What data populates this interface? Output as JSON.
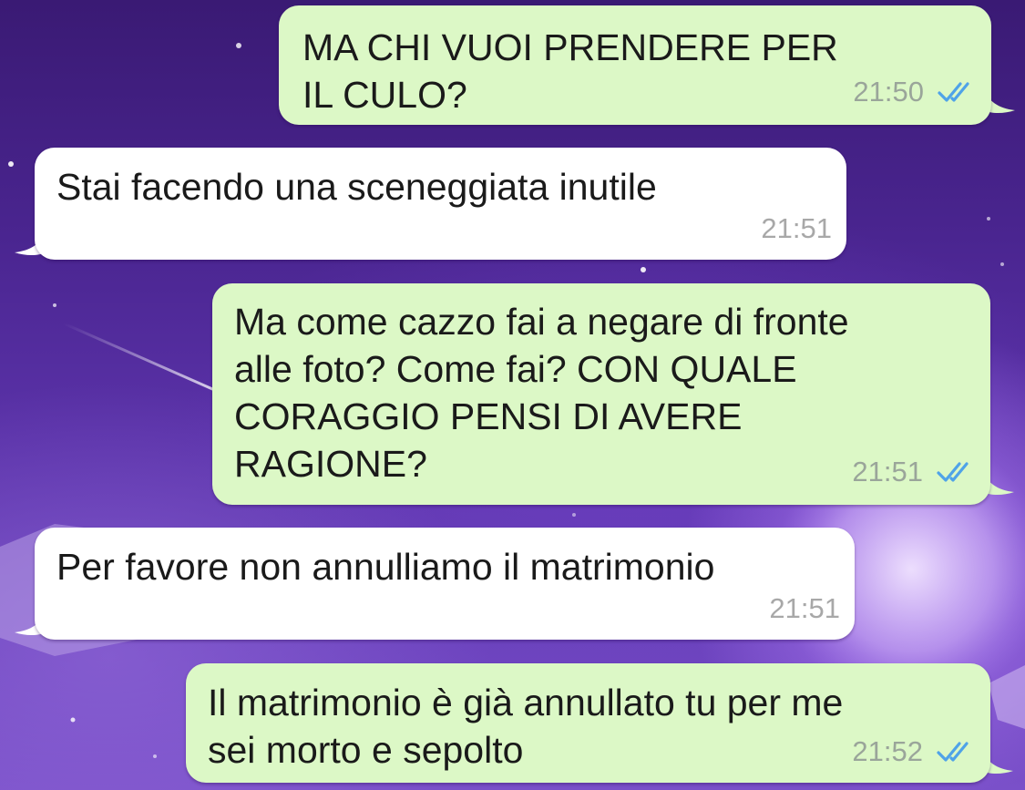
{
  "conversation": {
    "messages": [
      {
        "direction": "outgoing",
        "text": "MA CHI VUOI PRENDERE PER\nIL CULO?",
        "time": "21:50",
        "status_icon": "double-check-read-icon"
      },
      {
        "direction": "incoming",
        "text": "Stai facendo una sceneggiata inutile",
        "time": "21:51"
      },
      {
        "direction": "outgoing",
        "text": "Ma come cazzo fai a negare di fronte\nalle foto? Come fai? CON QUALE\nCORAGGIO PENSI DI AVERE\nRAGIONE?",
        "time": "21:51",
        "status_icon": "double-check-read-icon"
      },
      {
        "direction": "incoming",
        "text": "Per favore non annulliamo il matrimonio",
        "time": "21:51"
      },
      {
        "direction": "outgoing",
        "text": "Il matrimonio è già annullato tu per me\nsei morto e sepolto",
        "time": "21:52",
        "status_icon": "double-check-read-icon"
      }
    ]
  },
  "colors": {
    "outgoing_bubble": "#dcf8c6",
    "incoming_bubble": "#ffffff",
    "read_check": "#4fa3e8",
    "wallpaper": "#4a2590"
  }
}
